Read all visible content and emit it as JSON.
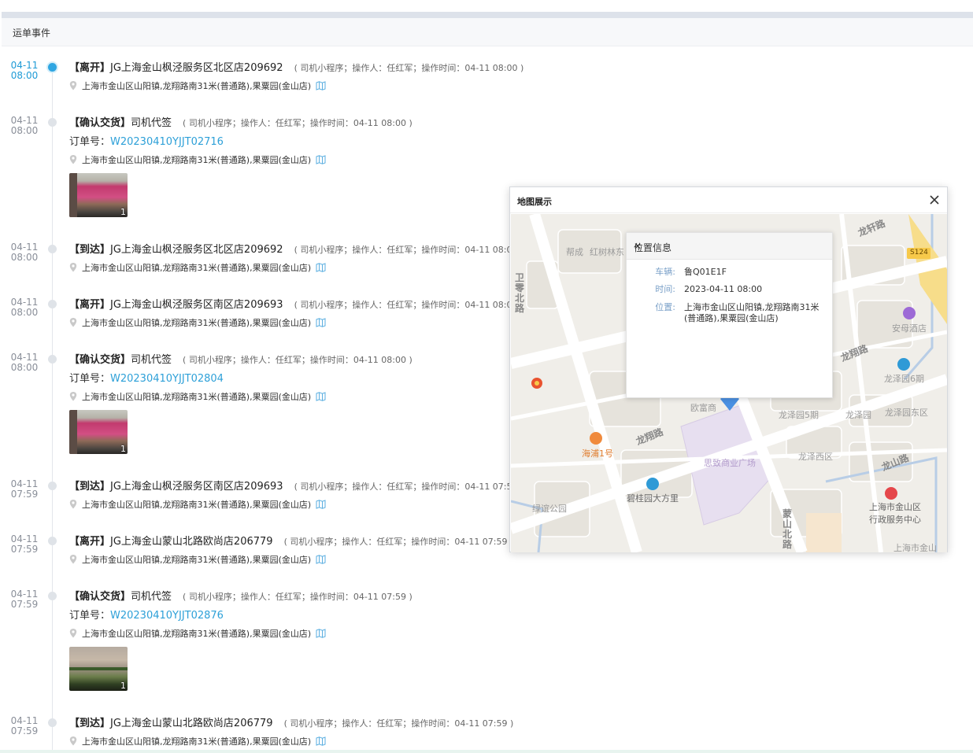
{
  "section": {
    "title": "运单事件"
  },
  "events": [
    {
      "date": "04-11",
      "time": "08:00",
      "action": "【离开】",
      "place": "JG上海金山枫泾服务区北区店209692",
      "meta": "( 司机小程序；操作人：任红军；操作时间：04-11 08:00 )",
      "address": "上海市金山区山阳镇,龙翔路南31米(普通路),果粟园(金山店)"
    },
    {
      "date": "04-11",
      "time": "08:00",
      "action": "【确认交货】",
      "place": "司机代签",
      "meta": "( 司机小程序；操作人：任红军；操作时间：04-11 08:00 )",
      "order_label": "订单号：",
      "order_no": "W20230410YJJT02716",
      "address": "上海市金山区山阳镇,龙翔路南31米(普通路),果粟园(金山店)",
      "photo_count": "1"
    },
    {
      "date": "04-11",
      "time": "08:00",
      "action": "【到达】",
      "place": "JG上海金山枫泾服务区北区店209692",
      "meta": "( 司机小程序；操作人：任红军；操作时间：04-11 08:00 )",
      "address": "上海市金山区山阳镇,龙翔路南31米(普通路),果粟园(金山店)"
    },
    {
      "date": "04-11",
      "time": "08:00",
      "action": "【离开】",
      "place": "JG上海金山枫泾服务区南区店209693",
      "meta": "( 司机小程序；操作人：任红军；操作时间：04-11 08:00 )",
      "address": "上海市金山区山阳镇,龙翔路南31米(普通路),果粟园(金山店)"
    },
    {
      "date": "04-11",
      "time": "08:00",
      "action": "【确认交货】",
      "place": "司机代签",
      "meta": "( 司机小程序；操作人：任红军；操作时间：04-11 08:00 )",
      "order_label": "订单号：",
      "order_no": "W20230410YJJT02804",
      "address": "上海市金山区山阳镇,龙翔路南31米(普通路),果粟园(金山店)",
      "photo_count": "1"
    },
    {
      "date": "04-11",
      "time": "07:59",
      "action": "【到达】",
      "place": "JG上海金山枫泾服务区南区店209693",
      "meta": "( 司机小程序；操作人：任红军；操作时间：04-11 07:59 )",
      "address": "上海市金山区山阳镇,龙翔路南31米(普通路),果粟园(金山店)"
    },
    {
      "date": "04-11",
      "time": "07:59",
      "action": "【离开】",
      "place": "JG上海金山蒙山北路欧尚店206779",
      "meta": "( 司机小程序；操作人：任红军；操作时间：04-11 07:59 )",
      "address": "上海市金山区山阳镇,龙翔路南31米(普通路),果粟园(金山店)"
    },
    {
      "date": "04-11",
      "time": "07:59",
      "action": "【确认交货】",
      "place": "司机代签",
      "meta": "( 司机小程序；操作人：任红军；操作时间：04-11 07:59 )",
      "order_label": "订单号：",
      "order_no": "W20230410YJJT02876",
      "address": "上海市金山区山阳镇,龙翔路南31米(普通路),果粟园(金山店)",
      "photo_count": "1"
    },
    {
      "date": "04-11",
      "time": "07:59",
      "action": "【到达】",
      "place": "JG上海金山蒙山北路欧尚店206779",
      "meta": "( 司机小程序；操作人：任红军；操作时间：04-11 07:59 )",
      "address": "上海市金山区山阳镇,龙翔路南31米(普通路),果粟园(金山店)"
    }
  ],
  "map_dialog": {
    "title": "地图展示",
    "info": {
      "title": "位置信息",
      "vehicle_label": "车辆:",
      "vehicle": "鲁Q01E1F",
      "time_label": "时间:",
      "time": "2023-04-11 08:00",
      "location_label": "位置:",
      "location": "上海市金山区山阳镇,龙翔路南31米(普通路),果粟园(金山店)"
    },
    "labels": {
      "road_longxuan": "龙轩路",
      "road_longxiang": "龙翔路",
      "road_longxiang_2": "龙翔路",
      "road_longshan": "龙山路",
      "road_mengshan": "蒙山北路",
      "road_s124": "S124",
      "road_west": "卫零北路",
      "anmu_hotel": "安母酒店",
      "longzeyuan6": "龙泽园6期",
      "longzeyuan5": "龙泽园5期",
      "longze_west": "龙泽西区",
      "longze_yuan": "龙泽园",
      "longze_east": "龙泽园东区",
      "haipu": "海浦1号",
      "biguiyuan": "碧桂园大方里",
      "sizhi": "思致商业广场",
      "ouyang": "欧富商",
      "jinshan_gov": "上海市金山区行政服务中心",
      "jinshan_corner": "上海市金山",
      "park": "绿谊公园",
      "lefttop": "帮成",
      "lefttop2": "红树林东"
    }
  }
}
